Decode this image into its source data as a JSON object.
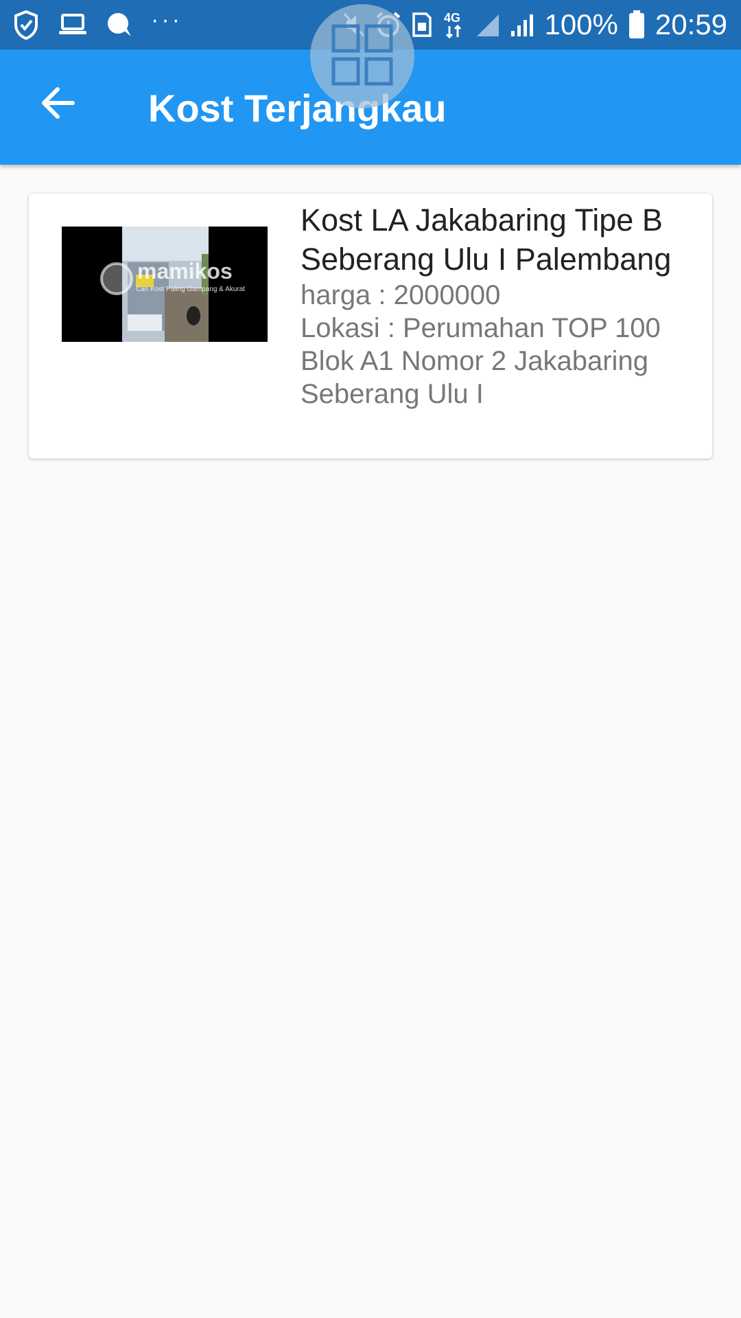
{
  "status_bar": {
    "battery_text": "100%",
    "time": "20:59",
    "network_type": "4G",
    "left_icons": [
      "shield-icon",
      "laptop-icon",
      "chat-bubble-icon",
      "more-icon"
    ],
    "right_icons": [
      "mute-icon",
      "alarm-icon",
      "sim-icon",
      "network-4g-icon",
      "signal-icon",
      "signal-icon",
      "battery-icon"
    ]
  },
  "app_bar": {
    "title": "Kost Terjangkau",
    "back_icon": "arrow-back-icon",
    "color": "#2196f3"
  },
  "overlay": {
    "icon": "grid-icon"
  },
  "listings": [
    {
      "name": "Kost LA Jakabaring Tipe B Seberang Ulu I Palembang",
      "price": "harga : 2000000",
      "location": "Lokasi : Perumahan TOP 100 Blok A1 Nomor 2 Jakabaring Seberang Ulu I",
      "image_watermark": "mamikos",
      "image_caption": "Cari Kost Paling Gampang & Akurat"
    }
  ]
}
